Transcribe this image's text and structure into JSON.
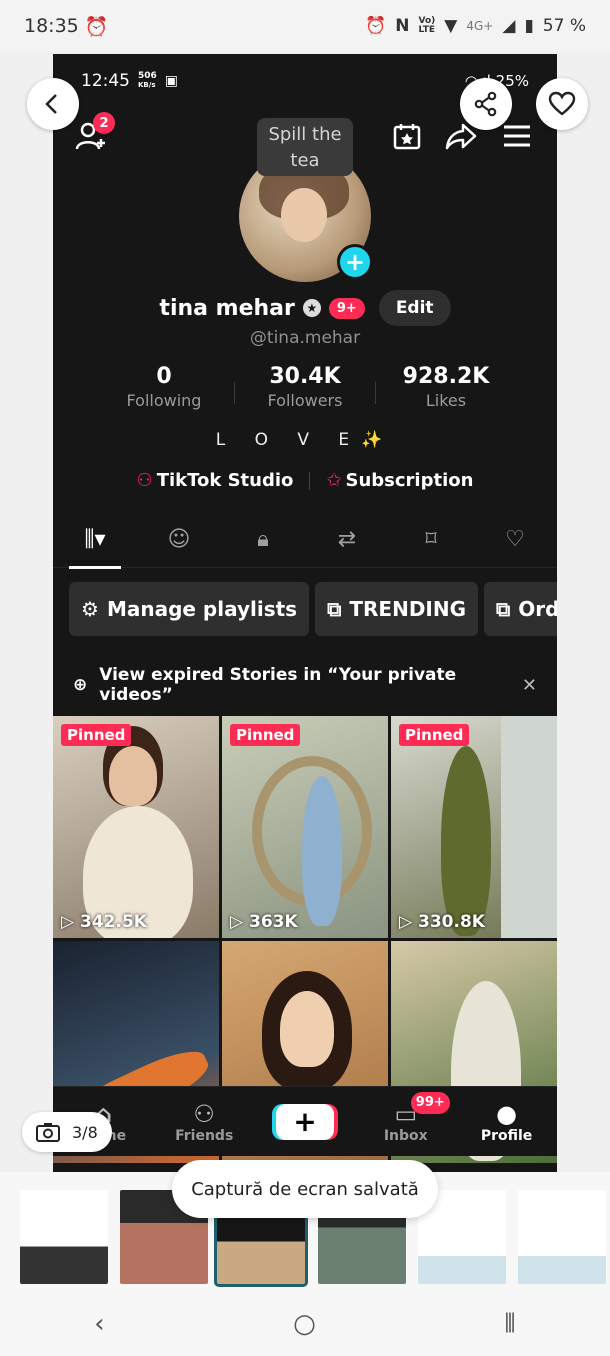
{
  "outer_status": {
    "time": "18:35",
    "alarm": "alarm-icon",
    "network": "4G+",
    "battery": "57 %"
  },
  "inner_status": {
    "time": "12:45",
    "speed": "506",
    "speed_unit": "KB/s",
    "battery": "25%"
  },
  "profile": {
    "spill_label": "Spill the tea",
    "name": "tina mehar",
    "notif_badge": "9+",
    "edit_label": "Edit",
    "handle": "@tina.mehar",
    "add_friends_badge": "2",
    "stats": [
      {
        "value": "0",
        "label": "Following"
      },
      {
        "value": "30.4K",
        "label": "Followers"
      },
      {
        "value": "928.2K",
        "label": "Likes"
      }
    ],
    "bio": "L O V E✨",
    "links": [
      {
        "label": "TikTok Studio",
        "icon": "studio-icon"
      },
      {
        "label": "Subscription",
        "icon": "subscription-icon"
      }
    ]
  },
  "tabs": [
    "videos-grid-icon",
    "stickers-icon",
    "lock-icon",
    "repost-icon",
    "bookmark-icon",
    "heart-icon"
  ],
  "pills": [
    {
      "label": "Manage playlists",
      "icon": "gear-icon"
    },
    {
      "label": "TRENDING",
      "icon": "playlist-icon"
    },
    {
      "label": "Ord",
      "icon": "playlist-icon"
    }
  ],
  "stories_notice": "View expired Stories in “Your private videos”",
  "videos": [
    {
      "pinned": "Pinned",
      "views": "342.5K"
    },
    {
      "pinned": "Pinned",
      "views": "363K"
    },
    {
      "pinned": "Pinned",
      "views": "330.8K"
    },
    {
      "pinned": "",
      "views": ""
    },
    {
      "pinned": "",
      "views": ""
    },
    {
      "pinned": "",
      "views": ""
    }
  ],
  "bottom_nav": [
    {
      "label": "Home",
      "icon": "home-icon"
    },
    {
      "label": "Friends",
      "icon": "friends-icon"
    },
    {
      "label": "",
      "icon": "create-icon"
    },
    {
      "label": "Inbox",
      "icon": "inbox-icon",
      "badge": "99+"
    },
    {
      "label": "Profile",
      "icon": "profile-icon"
    }
  ],
  "viewer": {
    "counter": "3/8",
    "toast": "Captură de ecran salvată"
  },
  "colors": {
    "accent": "#fe2c55",
    "cyan": "#20d5ec",
    "selected_thumb": "#1f5f6b"
  }
}
